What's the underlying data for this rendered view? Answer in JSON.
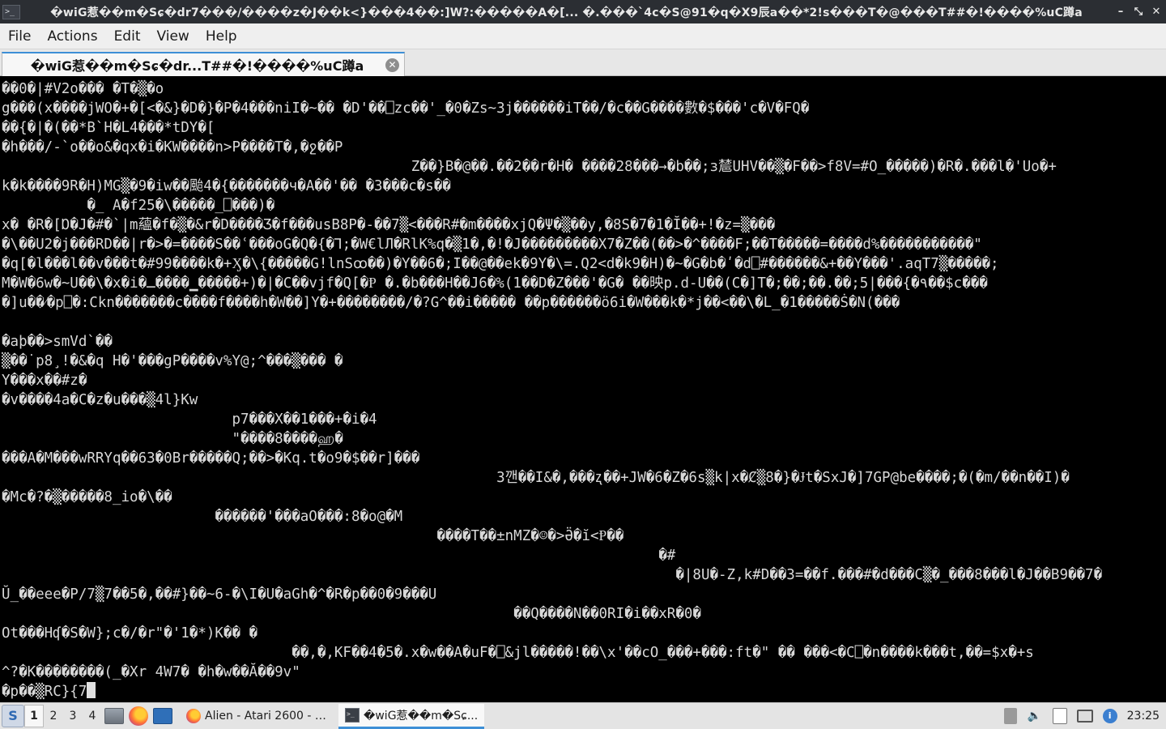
{
  "window": {
    "title": "�wiG惹��m�Sɕ�dr7���/����z�J��k<}���4��:]W?:�����A�[...  �.���`4c�S@91�q�X9辰a��*2!s���T�@���T##�!����%uC蹲a",
    "minimize_glyph": "–",
    "maximize_glyph": "⤡",
    "close_glyph": "✕",
    "app_icon_glyph": ">_"
  },
  "menu": {
    "items": [
      "File",
      "Actions",
      "Edit",
      "View",
      "Help"
    ]
  },
  "tab": {
    "label": "�wiG惹��m�Sɕ�dr...T##�!����%uC蹲a",
    "close_glyph": "✕"
  },
  "terminal": {
    "lines": [
      "��0�|#V2o��� �T�▒�o",
      "g���(x����jWO�+�[<�&}�D�}�P�4���niI�~�� �D'��⎕zc��'_�0�Zs~3j������iT��/�c��G����數�$���'c�V�FQ�",
      "��{�|�(��*B`H�L4���*tDY�[",
      "�h���/-`o��o&�qx�i�KW����n>P����T�,�ջ��P",
      "                                                Z��}B�@��.��2��r�H� ����28���→�b��;ɜ㯄UHV��▒�F��>f8V=#O_�����)�R�.���l�'Uo�+",
      "k�k����9R�H)MG▒�9�iw��颱4�{�������ч�A��'�� �3���c�s��",
      "          �_ A�f25�\\�����_⎕���)�",
      "x� �R�[Ɒ�J�#�`|m蘊�f�▒�&r�D����Ʒ�f���usB8P�-��7▒<���R#�m����xjQ�Ψ�▒��y,�8S�7�1�Ĭ��+!�z=▒���",
      "�\\��U2�j���RD��|r�>�=����S��ʿ���oG�Q�{�Ꞁ;�W€lЛ�RlK%q�▒1�,�!�J���������X7�Z��(��>�^����F;��T�����=����d%�����������\"",
      "�q[�l���l��v���t�#99����k�+Ӽ�\\{�����G!lnSꝏ��)�Y��6�;I��@��ek�9Y�\\=.Q2<d�k9�H)�~�G�b�ʹ�d⎕#������&+��Y���'.aqT7▒�����;",
      "M�W�6w�~U��\\�x�i�ـ����▁�����+)�|�C��vjf�Q[�Ᵽ �.�b���H��J6�%(1��D�Z���'�G� ��映p.d-U��(C�]T�;��;��.��;5|���{�٩��$c���",
      "�]u��⁄�p⎕�:Ckn�������c����f����h�W��]Y�+��������/�?G^��i����� ��p������ö6i�W���k�*j��<��\\�L_�1�����Ṡ�N(���",
      "",
      "�aþ��>smVd`��",
      "▒��˙p8¸!�&�q H�'���gP����v%Y@;^���▒��� �",
      "Y���x��#z�",
      "�v����4a�C�z�u���▒4l}Kw",
      "                           p7���X��1���+�i�4",
      "                           \"����8����ஹ�",
      "���A�M���wRRYq��63�0Br�����Q;��>�Kq.t�o9�$��r]���",
      "                                                          3깬��I&�,���ʐ��+JW�6�Z�6s▒k|x�Ȼ▒8�}�Ɉt�SxJ�]7GP@be����;�(�m/��n��I)�",
      "�Mc�?�▒�����8_io�\\��",
      "                         ������'���aO���:8�o@�M",
      "                                                   ����T��±nMZ�☺�>Ӛ�ĭ<Ᵽ��",
      "                                                                             �#",
      "                                                                               �|8U�-Z,k#D��3=��f.���#�d���C▒�_���8���l�J��B9��7�",
      "Ŭ_��eee�P/7▒7��5�,��#}��~6-�\\I�U�aGh�^�R�p��0�9���U",
      "                                                            ��Q����N��0RI�i��xR�0�",
      "Ot���Hʠ�S�W};c�/�r\"�'1�*)K�� �",
      "                                  ��,�,KF��4�5�.x�w��A�uF�⎕&jl�����!��\\x'��cO_���+���:ft�\" �� ���<�C⎕�n����k���t,��=$x�+s",
      "^?�K��������(_�Xr 4W7� �h�w��Ă��9v\"",
      "�p��▒RC}{7"
    ]
  },
  "taskbar": {
    "start_glyph": "S",
    "workspaces": [
      "1",
      "2",
      "3",
      "4"
    ],
    "active_workspace_index": 0,
    "launchers": [
      "file-manager-icon",
      "firefox-icon",
      "terminal-icon"
    ],
    "tasks": [
      {
        "label": "Alien - Atari 2600 - Ji...",
        "icon": "firefox-icon",
        "active": false
      },
      {
        "label": "�wiG惹��m�Sɕ...",
        "icon": "terminal-icon",
        "active": true
      }
    ],
    "tray": {
      "keyboard_icon": "keyboard-icon",
      "volume_glyph": "🔈",
      "clock": "23:25"
    }
  },
  "colors": {
    "titlebar_bg": "#2b2e33",
    "terminal_bg": "#000000",
    "terminal_fg": "#d8d8d8",
    "accent": "#3d8fd6"
  }
}
